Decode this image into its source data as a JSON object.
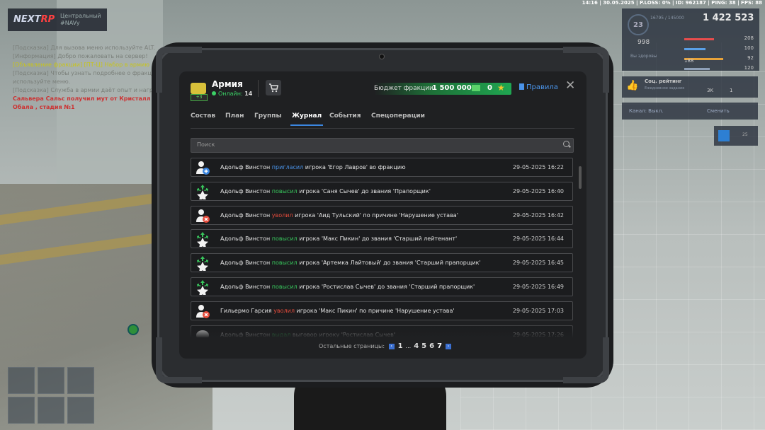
{
  "hud": {
    "topbar": "14:16 | 30.05.2025 | P.LOSS: 0% | ID: 962187 | PING: 38 | FPS: 88",
    "logo": {
      "brand_a": "NEXT",
      "brand_b": "RP",
      "server": "Центральный",
      "server_sub": "#NAVy"
    },
    "chat": [
      {
        "text": "[Подсказка] Для вызова меню используйте ALT.",
        "style": "gray"
      },
      {
        "text": "[Информация] Добро пожаловать на сервер!",
        "style": "gray"
      },
      {
        "text": "[Объявление фракции] [ПТ-Ц] Набор в армию",
        "style": "yel"
      },
      {
        "text": "[Подсказка] Чтобы узнать подробнее о фракции, используйте меню.",
        "style": "gray"
      },
      {
        "text": "[Подсказка] Служба в армии даёт опыт и награды.",
        "style": "gray"
      },
      {
        "text": "Сальвера Сальс получил мут от Кристалл Обала , стадия №1",
        "style": "red"
      }
    ],
    "stats": {
      "level": "23",
      "xp_label": "16795 / 145000",
      "money": "1 422 523",
      "armor_label": "Вы здоровы",
      "ammo": "998",
      "rows": [
        {
          "value": "208",
          "color": "#e84d4d",
          "fill": 0.7
        },
        {
          "value": "100",
          "color": "#5aa0e8",
          "fill": 0.5
        },
        {
          "value": "92",
          "color": "#e8a33a",
          "fill": 0.92
        },
        {
          "value": "120",
          "color": "#8fa0b8",
          "fill": 0.6
        }
      ],
      "bottom": "188"
    },
    "rating": {
      "title": "Соц. рейтинг",
      "sub": "Ежедневное задание",
      "c1": "3K",
      "c2": "1"
    },
    "channel": {
      "left": "Канал: Выкл.",
      "right": "Сменить"
    },
    "cal_badge": "25"
  },
  "faction": {
    "name": "Армия",
    "online_label": "Онлайн:",
    "online_count": "14",
    "badge": "+3",
    "budget_label": "Бюджет фракции:",
    "budget_value": "1 500 000",
    "budget_stars": "0",
    "rules_label": "Правила",
    "tabs": [
      "Состав",
      "План",
      "Группы",
      "Журнал",
      "События",
      "Спецоперации"
    ],
    "active_tab": "Журнал",
    "search_placeholder": "Поиск"
  },
  "log": [
    {
      "type": "invite",
      "actor": "Адольф Винстон",
      "action": "пригласил",
      "rest": "игрока 'Егор Лавров' во фракцию",
      "date": "29-05-2025 16:22"
    },
    {
      "type": "promote",
      "actor": "Адольф Винстон",
      "action": "повысил",
      "rest": "игрока 'Саня Сычев' до звания 'Прапорщик'",
      "date": "29-05-2025 16:40"
    },
    {
      "type": "fire",
      "actor": "Адольф Винстон",
      "action": "уволил",
      "rest": "игрока 'Аид Тульский' по причине 'Нарушение устава'",
      "date": "29-05-2025 16:42"
    },
    {
      "type": "promote",
      "actor": "Адольф Винстон",
      "action": "повысил",
      "rest": "игрока 'Макс Пикин' до звания 'Старший лейтенант'",
      "date": "29-05-2025 16:44"
    },
    {
      "type": "promote",
      "actor": "Адольф Винстон",
      "action": "повысил",
      "rest": "игрока 'Артемка Лайтовый' до звания 'Старший прапорщик'",
      "date": "29-05-2025 16:45"
    },
    {
      "type": "promote",
      "actor": "Адольф Винстон",
      "action": "повысил",
      "rest": "игрока 'Ростислав Сычев' до звания 'Старший прапорщик'",
      "date": "29-05-2025 16:49"
    },
    {
      "type": "fire",
      "actor": "Гильермо Гарсия",
      "action": "уволил",
      "rest": "игрока 'Макс Пикин' по причине 'Нарушение устава'",
      "date": "29-05-2025 17:03"
    },
    {
      "type": "reprimand",
      "actor": "Адольф Винстон",
      "action": "выдал",
      "rest": "выговор игроку 'Ростислав Сычев'",
      "date": "29-05-2025 17:26"
    }
  ],
  "pager": {
    "label": "Остальные страницы:",
    "pages": [
      "1",
      "...",
      "4",
      "5",
      "6",
      "7"
    ],
    "current": "7"
  },
  "colors": {
    "accent": "#3b86e0",
    "green": "#38c55c",
    "red": "#e74c3c",
    "blue": "#4a93e8"
  }
}
